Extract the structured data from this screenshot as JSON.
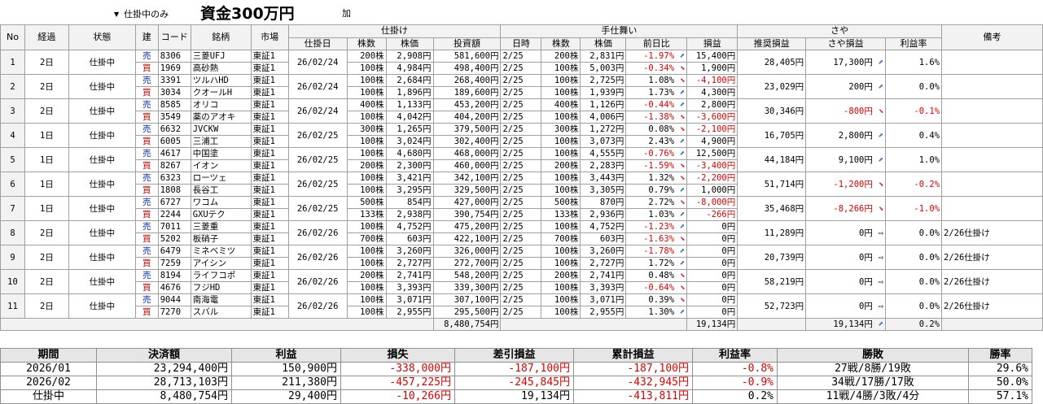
{
  "toolbar": {
    "filter_value": "仕掛中のみ",
    "capital": "資金300万円",
    "add_label": "加"
  },
  "headers": {
    "no": "No",
    "elapsed": "経過",
    "status": "状態",
    "side": "建",
    "code": "コード",
    "name": "銘柄",
    "market": "市場",
    "group_entry": "仕掛け",
    "entry_date": "仕掛日",
    "entry_qty": "株数",
    "entry_price": "株価",
    "investment": "投資額",
    "group_exit": "手仕舞い",
    "exit_date": "日時",
    "exit_qty": "株数",
    "exit_price": "株価",
    "day_change": "前日比",
    "pnl": "損益",
    "group_spread": "さや",
    "rec_pnl": "推奨損益",
    "spread_pnl": "さや損益",
    "profit_rate": "利益率",
    "note": "備考"
  },
  "rows": [
    {
      "no": "1",
      "elapsed": "2日",
      "status": "仕掛中",
      "date": "26/02/24",
      "spread_rec": "28,405円",
      "spread_pnl": "17,300円",
      "spread_dir": "up",
      "rate": "1.6%",
      "note": "",
      "legs": [
        {
          "side": "売",
          "code": "8306",
          "name": "三菱UFJ",
          "market": "東証1",
          "qty": "200株",
          "price": "2,908円",
          "inv": "581,600円",
          "xdate": "2/25",
          "xqty": "200株",
          "xprice": "2,831円",
          "chg": "-1.97%",
          "chg_dir": "up",
          "pnl": "15,400円"
        },
        {
          "side": "買",
          "code": "1969",
          "name": "高砂熱",
          "market": "東証1",
          "qty": "100株",
          "price": "4,984円",
          "inv": "498,400円",
          "xdate": "2/25",
          "xqty": "100株",
          "xprice": "5,003円",
          "chg": "-0.34%",
          "chg_dir": "dn",
          "pnl": "1,900円"
        }
      ]
    },
    {
      "no": "2",
      "elapsed": "2日",
      "status": "仕掛中",
      "date": "26/02/24",
      "spread_rec": "23,029円",
      "spread_pnl": "200円",
      "spread_dir": "up",
      "rate": "0.0%",
      "note": "",
      "legs": [
        {
          "side": "売",
          "code": "3391",
          "name": "ツルハHD",
          "market": "東証1",
          "qty": "100株",
          "price": "2,684円",
          "inv": "268,400円",
          "xdate": "2/25",
          "xqty": "100株",
          "xprice": "2,725円",
          "chg": "1.08%",
          "chg_dir": "dn",
          "pnl": "-4,100円"
        },
        {
          "side": "買",
          "code": "3034",
          "name": "クオールH",
          "market": "東証1",
          "qty": "100株",
          "price": "1,896円",
          "inv": "189,600円",
          "xdate": "2/25",
          "xqty": "100株",
          "xprice": "1,939円",
          "chg": "1.73%",
          "chg_dir": "up",
          "pnl": "4,300円"
        }
      ]
    },
    {
      "no": "3",
      "elapsed": "2日",
      "status": "仕掛中",
      "date": "26/02/24",
      "spread_rec": "30,346円",
      "spread_pnl": "-800円",
      "spread_dir": "dn",
      "rate": "-0.1%",
      "note": "",
      "legs": [
        {
          "side": "売",
          "code": "8585",
          "name": "オリコ",
          "market": "東証1",
          "qty": "400株",
          "price": "1,133円",
          "inv": "453,200円",
          "xdate": "2/25",
          "xqty": "400株",
          "xprice": "1,126円",
          "chg": "-0.44%",
          "chg_dir": "up",
          "pnl": "2,800円"
        },
        {
          "side": "買",
          "code": "3549",
          "name": "薬のアオキ",
          "market": "東証1",
          "qty": "100株",
          "price": "4,042円",
          "inv": "404,200円",
          "xdate": "2/25",
          "xqty": "100株",
          "xprice": "4,006円",
          "chg": "-1.38%",
          "chg_dir": "dn",
          "pnl": "-3,600円"
        }
      ]
    },
    {
      "no": "4",
      "elapsed": "1日",
      "status": "仕掛中",
      "date": "26/02/25",
      "spread_rec": "16,705円",
      "spread_pnl": "2,800円",
      "spread_dir": "up",
      "rate": "0.4%",
      "note": "",
      "legs": [
        {
          "side": "売",
          "code": "6632",
          "name": "JVCKW",
          "market": "東証1",
          "qty": "300株",
          "price": "1,265円",
          "inv": "379,500円",
          "xdate": "2/25",
          "xqty": "300株",
          "xprice": "1,272円",
          "chg": "0.08%",
          "chg_dir": "dn",
          "pnl": "-2,100円"
        },
        {
          "side": "買",
          "code": "6005",
          "name": "三浦工",
          "market": "東証1",
          "qty": "100株",
          "price": "3,024円",
          "inv": "302,400円",
          "xdate": "2/25",
          "xqty": "100株",
          "xprice": "3,073円",
          "chg": "2.43%",
          "chg_dir": "up",
          "pnl": "4,900円"
        }
      ]
    },
    {
      "no": "5",
      "elapsed": "1日",
      "status": "仕掛中",
      "date": "26/02/25",
      "spread_rec": "44,184円",
      "spread_pnl": "9,100円",
      "spread_dir": "up",
      "rate": "1.0%",
      "note": "",
      "legs": [
        {
          "side": "売",
          "code": "4617",
          "name": "中国塗",
          "market": "東証1",
          "qty": "100株",
          "price": "4,680円",
          "inv": "468,000円",
          "xdate": "2/25",
          "xqty": "100株",
          "xprice": "4,555円",
          "chg": "-0.76%",
          "chg_dir": "up",
          "pnl": "12,500円"
        },
        {
          "side": "買",
          "code": "8267",
          "name": "イオン",
          "market": "東証1",
          "qty": "200株",
          "price": "2,300円",
          "inv": "460,000円",
          "xdate": "2/25",
          "xqty": "200株",
          "xprice": "2,283円",
          "chg": "-1.59%",
          "chg_dir": "dn",
          "pnl": "-3,400円"
        }
      ]
    },
    {
      "no": "6",
      "elapsed": "1日",
      "status": "仕掛中",
      "date": "26/02/25",
      "spread_rec": "51,714円",
      "spread_pnl": "-1,200円",
      "spread_dir": "dn",
      "rate": "-0.2%",
      "note": "",
      "legs": [
        {
          "side": "売",
          "code": "6323",
          "name": "ローツェ",
          "market": "東証1",
          "qty": "100株",
          "price": "3,421円",
          "inv": "342,100円",
          "xdate": "2/25",
          "xqty": "100株",
          "xprice": "3,443円",
          "chg": "1.32%",
          "chg_dir": "dn",
          "pnl": "-2,200円"
        },
        {
          "side": "買",
          "code": "1808",
          "name": "長谷工",
          "market": "東証1",
          "qty": "100株",
          "price": "3,295円",
          "inv": "329,500円",
          "xdate": "2/25",
          "xqty": "100株",
          "xprice": "3,305円",
          "chg": "0.79%",
          "chg_dir": "up",
          "pnl": "1,000円"
        }
      ]
    },
    {
      "no": "7",
      "elapsed": "1日",
      "status": "仕掛中",
      "date": "26/02/25",
      "spread_rec": "35,468円",
      "spread_pnl": "-8,266円",
      "spread_dir": "dn",
      "rate": "-1.0%",
      "note": "",
      "legs": [
        {
          "side": "売",
          "code": "6727",
          "name": "ワコム",
          "market": "東証1",
          "qty": "500株",
          "price": "854円",
          "inv": "427,000円",
          "xdate": "2/25",
          "xqty": "500株",
          "xprice": "870円",
          "chg": "2.72%",
          "chg_dir": "dn",
          "pnl": "-8,000円"
        },
        {
          "side": "買",
          "code": "2244",
          "name": "GXUテク",
          "market": "東証1",
          "qty": "133株",
          "price": "2,938円",
          "inv": "390,754円",
          "xdate": "2/25",
          "xqty": "133株",
          "xprice": "2,936円",
          "chg": "1.03%",
          "chg_dir": "up",
          "pnl": "-266円"
        }
      ]
    },
    {
      "no": "8",
      "elapsed": "2日",
      "status": "仕掛中",
      "date": "26/02/26",
      "spread_rec": "11,289円",
      "spread_pnl": "0円",
      "spread_dir": "flat",
      "rate": "0.0%",
      "note": "2/26仕掛け",
      "legs": [
        {
          "side": "売",
          "code": "7011",
          "name": "三菱重",
          "market": "東証1",
          "qty": "100株",
          "price": "4,752円",
          "inv": "475,200円",
          "xdate": "2/25",
          "xqty": "100株",
          "xprice": "4,752円",
          "chg": "-1.23%",
          "chg_dir": "up",
          "pnl": "0円"
        },
        {
          "side": "買",
          "code": "5202",
          "name": "板硝子",
          "market": "東証1",
          "qty": "700株",
          "price": "603円",
          "inv": "422,100円",
          "xdate": "2/25",
          "xqty": "700株",
          "xprice": "603円",
          "chg": "-1.63%",
          "chg_dir": "dn",
          "pnl": "0円"
        }
      ]
    },
    {
      "no": "9",
      "elapsed": "2日",
      "status": "仕掛中",
      "date": "26/02/26",
      "spread_rec": "20,739円",
      "spread_pnl": "0円",
      "spread_dir": "flat",
      "rate": "0.0%",
      "note": "2/26仕掛け",
      "legs": [
        {
          "side": "売",
          "code": "6479",
          "name": "ミネベミツ",
          "market": "東証1",
          "qty": "100株",
          "price": "3,260円",
          "inv": "326,000円",
          "xdate": "2/25",
          "xqty": "100株",
          "xprice": "3,260円",
          "chg": "-1.78%",
          "chg_dir": "up",
          "pnl": "0円"
        },
        {
          "side": "買",
          "code": "7259",
          "name": "アイシン",
          "market": "東証1",
          "qty": "100株",
          "price": "2,727円",
          "inv": "272,700円",
          "xdate": "2/25",
          "xqty": "100株",
          "xprice": "2,727円",
          "chg": "1.72%",
          "chg_dir": "up",
          "pnl": "0円"
        }
      ]
    },
    {
      "no": "10",
      "elapsed": "2日",
      "status": "仕掛中",
      "date": "26/02/26",
      "spread_rec": "58,219円",
      "spread_pnl": "0円",
      "spread_dir": "flat",
      "rate": "0.0%",
      "note": "2/26仕掛け",
      "legs": [
        {
          "side": "売",
          "code": "8194",
          "name": "ライフコポ",
          "market": "東証1",
          "qty": "200株",
          "price": "2,741円",
          "inv": "548,200円",
          "xdate": "2/25",
          "xqty": "200株",
          "xprice": "2,741円",
          "chg": "0.48%",
          "chg_dir": "dn",
          "pnl": "0円"
        },
        {
          "side": "買",
          "code": "4676",
          "name": "フジHD",
          "market": "東証1",
          "qty": "100株",
          "price": "3,393円",
          "inv": "339,300円",
          "xdate": "2/25",
          "xqty": "100株",
          "xprice": "3,393円",
          "chg": "-0.64%",
          "chg_dir": "dn",
          "pnl": "0円"
        }
      ]
    },
    {
      "no": "11",
      "elapsed": "2日",
      "status": "仕掛中",
      "date": "26/02/26",
      "spread_rec": "52,723円",
      "spread_pnl": "0円",
      "spread_dir": "flat",
      "rate": "0.0%",
      "note": "2/26仕掛け",
      "legs": [
        {
          "side": "売",
          "code": "9044",
          "name": "南海電",
          "market": "東証1",
          "qty": "100株",
          "price": "3,071円",
          "inv": "307,100円",
          "xdate": "2/25",
          "xqty": "100株",
          "xprice": "3,071円",
          "chg": "0.39%",
          "chg_dir": "dn",
          "pnl": "0円"
        },
        {
          "side": "買",
          "code": "7270",
          "name": "スバル",
          "market": "東証1",
          "qty": "100株",
          "price": "2,955円",
          "inv": "295,500円",
          "xdate": "2/25",
          "xqty": "100株",
          "xprice": "2,955円",
          "chg": "1.30%",
          "chg_dir": "up",
          "pnl": "0円"
        }
      ]
    }
  ],
  "totals": {
    "investment": "8,480,754円",
    "pnl": "19,134円",
    "spread_pnl": "19,134円",
    "spread_dir": "up",
    "rate": "0.2%"
  },
  "summary": {
    "headers": {
      "period": "期間",
      "settled": "決済額",
      "profit": "利益",
      "loss": "損失",
      "net": "差引損益",
      "cumulative": "累計損益",
      "rate": "利益率",
      "record": "勝敗",
      "winrate": "勝率"
    },
    "rows": [
      {
        "period": "2026/01",
        "settled": "23,294,400円",
        "profit": "150,900円",
        "loss": "-338,000円",
        "net": "-187,100円",
        "cumulative": "-187,100円",
        "rate": "-0.8%",
        "record": "27戦/8勝/19敗",
        "winrate": "29.6%"
      },
      {
        "period": "2026/02",
        "settled": "28,713,103円",
        "profit": "211,380円",
        "loss": "-457,225円",
        "net": "-245,845円",
        "cumulative": "-432,945円",
        "rate": "-0.9%",
        "record": "34戦/17勝/17敗",
        "winrate": "50.0%"
      },
      {
        "period": "仕掛中",
        "settled": "8,480,754円",
        "profit": "29,400円",
        "loss": "-10,266円",
        "net": "19,134円",
        "cumulative": "-413,811円",
        "rate": "0.2%",
        "record": "11戦/4勝/3敗/4分",
        "winrate": "57.1%"
      }
    ]
  },
  "colors": {
    "negative": "#e00000",
    "sell": "#1030c0",
    "buy": "#c00000",
    "up_arrow": "#2a6ad0",
    "down_arrow": "#d02030",
    "header_bg": "#f2f2f2"
  },
  "icons": {
    "up": "arrow-up-right-icon",
    "dn": "arrow-down-right-icon",
    "flat": "arrow-right-icon"
  }
}
